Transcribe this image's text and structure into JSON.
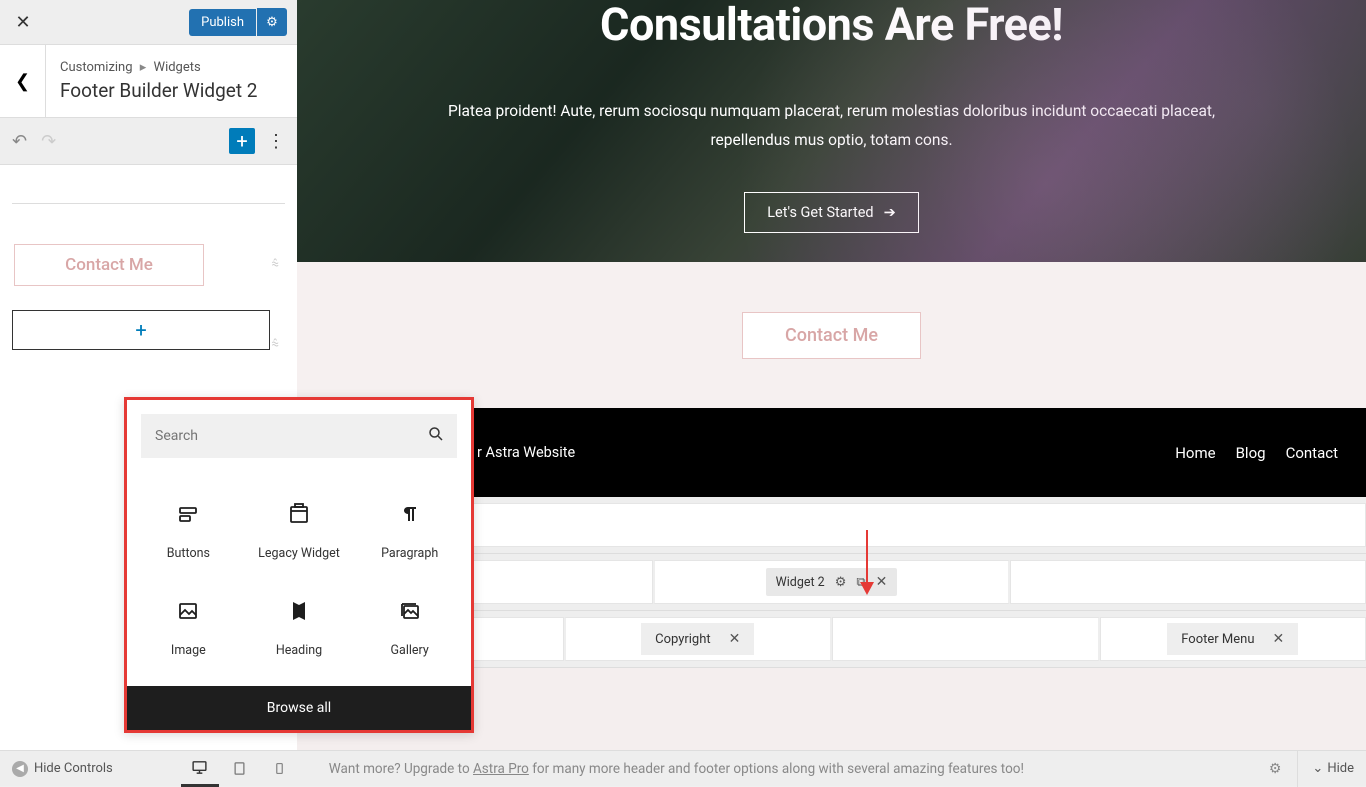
{
  "sidebar": {
    "publish_label": "Publish",
    "breadcrumb_root": "Customizing",
    "breadcrumb_leaf": "Widgets",
    "section_title": "Footer Builder Widget 2",
    "contact_btn": "Contact Me"
  },
  "block_picker": {
    "search_placeholder": "Search",
    "blocks": [
      {
        "label": "Buttons"
      },
      {
        "label": "Legacy Widget"
      },
      {
        "label": "Paragraph"
      },
      {
        "label": "Image"
      },
      {
        "label": "Heading"
      },
      {
        "label": "Gallery"
      }
    ],
    "browse_all": "Browse all"
  },
  "preview": {
    "hero_title": "Consultations Are Free!",
    "hero_text": "Platea proident! Aute, rerum sociosqu numquam placerat, rerum molestias doloribus incidunt occaecati placeat, repellendus mus optio, totam cons.",
    "hero_btn": "Let's Get Started",
    "contact_main": "Contact Me",
    "site_name": "r Astra Website",
    "nav": [
      "Home",
      "Blog",
      "Contact"
    ]
  },
  "builder": {
    "widget2": "Widget 2",
    "copyright": "Copyright",
    "footer_menu": "Footer Menu"
  },
  "bottom": {
    "hide_controls": "Hide Controls",
    "promo_pre": "Want more? Upgrade to ",
    "promo_link": "Astra Pro",
    "promo_post": " for many more header and footer options along with several amazing features too!",
    "hide": "Hide"
  }
}
